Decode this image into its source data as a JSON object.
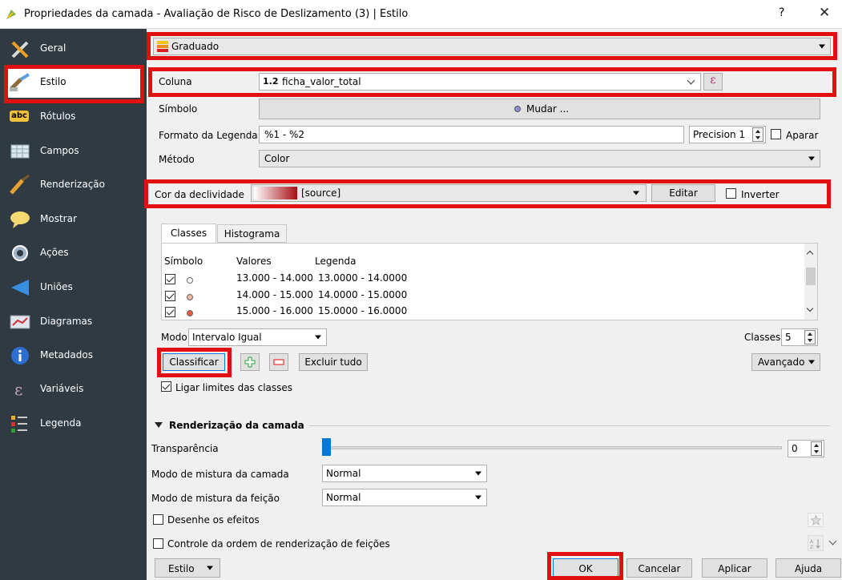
{
  "window": {
    "title": "Propriedades da camada - Avaliação de Risco de Deslizamento (3) | Estilo",
    "help": "?",
    "close": "✕"
  },
  "sidebar": {
    "items": [
      {
        "label": "Geral",
        "icon": "tools-icon"
      },
      {
        "label": "Estilo",
        "icon": "paintbrush-icon",
        "active": true
      },
      {
        "label": "Rótulos",
        "icon": "abc-label-icon"
      },
      {
        "label": "Campos",
        "icon": "table-fields-icon"
      },
      {
        "label": "Renderização",
        "icon": "render-brush-icon"
      },
      {
        "label": "Mostrar",
        "icon": "speech-bubble-icon"
      },
      {
        "label": "Ações",
        "icon": "gear-action-icon"
      },
      {
        "label": "Uniões",
        "icon": "join-arrow-icon"
      },
      {
        "label": "Diagramas",
        "icon": "diagram-icon"
      },
      {
        "label": "Metadados",
        "icon": "info-icon"
      },
      {
        "label": "Variáveis",
        "icon": "epsilon-icon"
      },
      {
        "label": "Legenda",
        "icon": "legend-icon"
      }
    ],
    "abc_text": "abc"
  },
  "renderer": {
    "type": "Graduado"
  },
  "coluna": {
    "label": "Coluna",
    "type_badge": "1.2",
    "value": "ficha_valor_total",
    "expr": "ε"
  },
  "simbolo": {
    "label": "Símbolo",
    "button": "Mudar ..."
  },
  "formato": {
    "label": "Formato da Legenda",
    "value": "%1 - %2",
    "precision": "Precision 1",
    "trim_label": "Aparar"
  },
  "metodo": {
    "label": "Método",
    "value": "Color"
  },
  "ramp": {
    "label": "Cor da declividade",
    "value": "[source]",
    "edit": "Editar",
    "invert": "Inverter"
  },
  "tabs": {
    "classes": "Classes",
    "histograma": "Histograma"
  },
  "table": {
    "headers": [
      "Símbolo",
      "Valores",
      "Legenda"
    ],
    "rows": [
      {
        "values": "13.000 - 14.000",
        "legend": "13.0000 - 14.0000",
        "color": "#ffffff"
      },
      {
        "values": "14.000 - 15.000",
        "legend": "14.0000 - 15.0000",
        "color": "#f5b5a0"
      },
      {
        "values": "15.000 - 16.000",
        "legend": "15.0000 - 16.0000",
        "color": "#e8573f"
      }
    ]
  },
  "modo": {
    "label": "Modo",
    "value": "Intervalo Igual",
    "classes_label": "Classes",
    "classes_value": "5"
  },
  "actions": {
    "classify": "Classificar",
    "delete_all": "Excluir tudo",
    "advanced": "Avançado",
    "link": "Ligar limites das classes"
  },
  "layer_render": {
    "header": "Renderização da camada",
    "transparency_label": "Transparência",
    "transparency_value": "0",
    "layer_blend_label": "Modo de mistura da camada",
    "layer_blend_value": "Normal",
    "feature_blend_label": "Modo de mistura da feição",
    "feature_blend_value": "Normal",
    "effects_label": "Desenhe os efeitos",
    "order_label": "Controle da ordem de renderização de feições"
  },
  "footer": {
    "style": "Estilo",
    "ok": "OK",
    "cancel": "Cancelar",
    "apply": "Aplicar",
    "help": "Ajuda"
  },
  "colors": {
    "highlight": "#e01010",
    "sidebar_bg": "#2f3a43",
    "ramp_start": "#ffffff",
    "ramp_end": "#a50f15"
  }
}
